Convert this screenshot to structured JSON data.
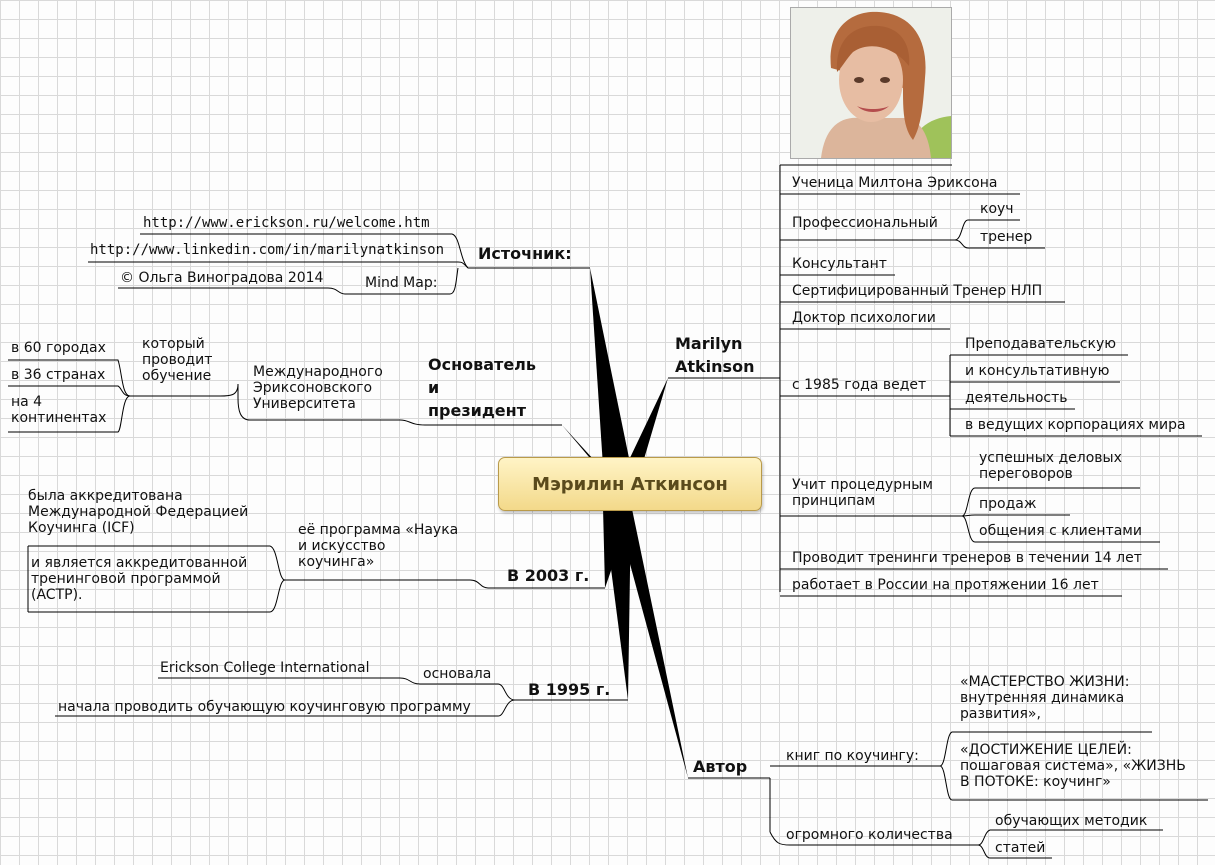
{
  "center": {
    "label": "Мэрилин Аткинсон"
  },
  "photo": {
    "description": "portrait of Marilyn Atkinson"
  },
  "colors": {
    "center_fill": "#f6e3a1",
    "center_border": "#b99a4a",
    "line": "#000000"
  },
  "source": {
    "title": "Источник:",
    "items": [
      "http://www.erickson.ru/welcome.htm",
      "http://www.linkedin.com/in/marilynatkinson",
      "© Ольга Виноградова 2014",
      "Mind Map:"
    ]
  },
  "founder": {
    "title": "Основатель\nи\nпрезидент",
    "university": "Международного\nЭриксоновского\nУниверситета",
    "conducts": "который\nпроводит\nобучение",
    "places": [
      "в 60 городах",
      "в 36 странах",
      "на 4\nконтинентах"
    ]
  },
  "y2003": {
    "title": "В 2003 г.",
    "program": "её программа «Наука\nи искусство\nкоучинга»",
    "accredited_icf": "была аккредитована\nМеждународной Федерацией\nКоучинга  (ICF)",
    "accredited_actp": "и является аккредитованной\nтренинговой программой\n(ACTP)."
  },
  "y1995": {
    "title": "В 1995 г.",
    "founded": "основала",
    "college": "Erickson College International",
    "started": "начала проводить обучающую коучинговую программу"
  },
  "marilyn": {
    "title": "Marilyn\nAtkinson",
    "student": "Ученица Милтона Эриксона",
    "professional": "Профессиональный",
    "coach": "коуч",
    "trainer": "тренер",
    "consultant": "Консультант",
    "nlp": "Сертифицированный Тренер НЛП",
    "doctor": "Доктор психологии",
    "since1985": "с 1985 года ведет",
    "act1": "Преподавательскую",
    "act2": "и консультативную",
    "act3": "деятельность",
    "act4": "в ведущих корпорациях мира",
    "teaches": "Учит процедурным\nпринципам",
    "p1": "успешных деловых\nпереговоров",
    "p2": "продаж",
    "p3": "общения с клиентами",
    "trainers": "Проводит тренинги тренеров в течении 14 лет",
    "russia": "работает в России на протяжении 16 лет"
  },
  "author": {
    "title": "Автор",
    "books": "книг по коучингу:",
    "book1": "«МАСТЕРСТВО ЖИЗНИ:\nвнутренняя динамика\nразвития»,",
    "book2": "«ДОСТИЖЕНИЕ ЦЕЛЕЙ:\nпошаговая система», «ЖИЗНЬ\nВ ПОТОКЕ: коучинг»",
    "many": "огромного количества",
    "methods": "обучающих методик",
    "articles": "статей"
  }
}
